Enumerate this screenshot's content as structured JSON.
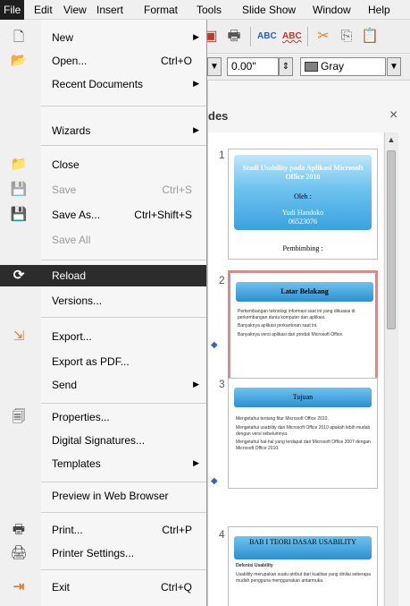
{
  "menubar": {
    "items": [
      "File",
      "Edit",
      "View",
      "Insert",
      "Format",
      "Tools",
      "Slide Show",
      "Window",
      "Help"
    ]
  },
  "toolbar": {
    "line_width": "0.00\"",
    "area_color": "Gray"
  },
  "slides_pane": {
    "title": "des",
    "close_glyph": "×",
    "slides": [
      {
        "number": "1",
        "title": "Studi Usability pada Aplikasi Microsoft Office 2010",
        "lines": [
          "Oleh :",
          "Yudi Handoko",
          "06523076",
          "Pembimbing :"
        ]
      },
      {
        "number": "2",
        "title": "Latar Belakang",
        "lines": [
          "Perkembangan teknologi informasi saat ini yang dikuasai di perkembangan dunia komputer dan aplikasi.",
          "Banyaknya aplikasi perkantoran saat ini.",
          "Banyaknya versi aplikasi dari produk Microsoft Office."
        ]
      },
      {
        "number": "3",
        "title": "Tujuan",
        "lines": [
          "Mengetahui tentang fitur Microsoft Office 2010.",
          "Mengetahui usability dari Microsoft Office 2010 apakah lebih mudah dengan versi sebelumnya.",
          "Mengetahui hal-hal yang terdapat dari Microsoft Office 2007 dengan Microsoft Office 2010."
        ]
      },
      {
        "number": "4",
        "title": "BAB I TEORI DASAR USABILITY",
        "lines": [
          "Defenisi Usability",
          "Usability merupakan suatu atribut dari kualitas yang dinilai seberapa mudah pengguna menggunakan antarmuka."
        ]
      }
    ]
  },
  "file_menu": {
    "items": [
      {
        "label": "New",
        "shortcut": "",
        "submenu": true,
        "icon": "new-document-icon",
        "glyph": "🗋",
        "disabled": false
      },
      {
        "label": "Open...",
        "shortcut": "Ctrl+O",
        "submenu": false,
        "icon": "open-folder-icon",
        "glyph": "📂",
        "disabled": false
      },
      {
        "label": "Recent Documents",
        "shortcut": "",
        "submenu": true,
        "icon": "",
        "glyph": "",
        "disabled": false
      },
      {
        "label": "Wizards",
        "shortcut": "",
        "submenu": true,
        "icon": "",
        "glyph": "",
        "disabled": false
      },
      {
        "label": "Close",
        "shortcut": "",
        "submenu": false,
        "icon": "close-document-icon",
        "glyph": "📁",
        "disabled": false
      },
      {
        "label": "Save",
        "shortcut": "Ctrl+S",
        "submenu": false,
        "icon": "save-icon",
        "glyph": "💾",
        "disabled": true
      },
      {
        "label": "Save As...",
        "shortcut": "Ctrl+Shift+S",
        "submenu": false,
        "icon": "save-as-icon",
        "glyph": "💾",
        "disabled": false
      },
      {
        "label": "Save All",
        "shortcut": "",
        "submenu": false,
        "icon": "",
        "glyph": "",
        "disabled": true
      },
      {
        "label": "Reload",
        "shortcut": "",
        "submenu": false,
        "icon": "reload-icon",
        "glyph": "⟳",
        "disabled": false,
        "highlighted": true
      },
      {
        "label": "Versions...",
        "shortcut": "",
        "submenu": false,
        "icon": "",
        "glyph": "",
        "disabled": false
      },
      {
        "label": "Export...",
        "shortcut": "",
        "submenu": false,
        "icon": "export-icon",
        "glyph": "⇲",
        "disabled": false
      },
      {
        "label": "Export as PDF...",
        "shortcut": "",
        "submenu": false,
        "icon": "",
        "glyph": "",
        "disabled": false
      },
      {
        "label": "Send",
        "shortcut": "",
        "submenu": true,
        "icon": "",
        "glyph": "",
        "disabled": false
      },
      {
        "label": "Properties...",
        "shortcut": "",
        "submenu": false,
        "icon": "properties-icon",
        "glyph": "🗐",
        "disabled": false
      },
      {
        "label": "Digital Signatures...",
        "shortcut": "",
        "submenu": false,
        "icon": "",
        "glyph": "",
        "disabled": false
      },
      {
        "label": "Templates",
        "shortcut": "",
        "submenu": true,
        "icon": "",
        "glyph": "",
        "disabled": false
      },
      {
        "label": "Preview in Web Browser",
        "shortcut": "",
        "submenu": false,
        "icon": "",
        "glyph": "",
        "disabled": false
      },
      {
        "label": "Print...",
        "shortcut": "Ctrl+P",
        "submenu": false,
        "icon": "print-icon",
        "glyph": "🖶",
        "disabled": false
      },
      {
        "label": "Printer Settings...",
        "shortcut": "",
        "submenu": false,
        "icon": "printer-settings-icon",
        "glyph": "🖨",
        "disabled": false
      },
      {
        "label": "Exit",
        "shortcut": "Ctrl+Q",
        "submenu": false,
        "icon": "exit-icon",
        "glyph": "⇥",
        "disabled": false
      }
    ]
  }
}
